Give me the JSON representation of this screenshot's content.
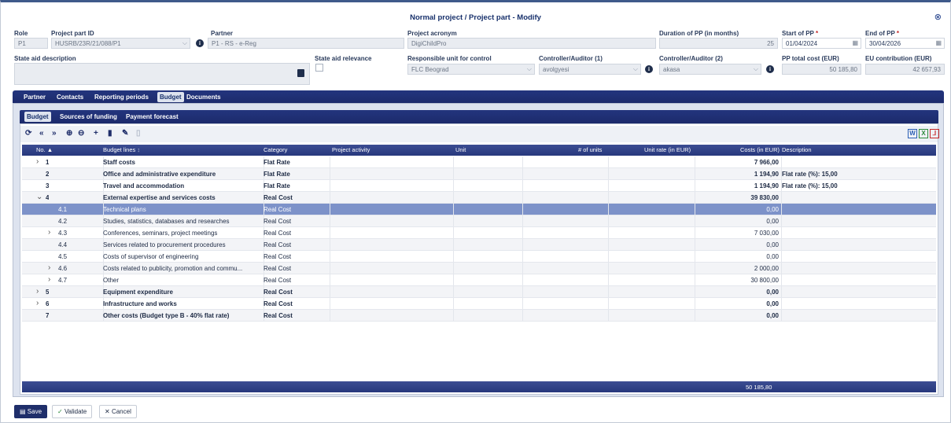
{
  "title": "Normal project / Project part - Modify",
  "form": {
    "role": {
      "label": "Role",
      "value": "P1"
    },
    "project_part_id": {
      "label": "Project part ID",
      "value": "HUSRB/23R/21/088/P1"
    },
    "partner": {
      "label": "Partner",
      "value": "P1 - RS - e-Reg"
    },
    "project_acronym": {
      "label": "Project acronym",
      "value": "DigiChildPro"
    },
    "duration": {
      "label": "Duration of PP (in months)",
      "value": "25"
    },
    "start": {
      "label": "Start of PP",
      "value": "01/04/2024"
    },
    "end": {
      "label": "End of PP",
      "value": "30/04/2026"
    },
    "state_aid_description": {
      "label": "State aid description",
      "value": ""
    },
    "state_aid_relevance": {
      "label": "State aid relevance"
    },
    "responsible_unit": {
      "label": "Responsible unit for control",
      "value": "FLC Beograd"
    },
    "controller1": {
      "label": "Controller/Auditor (1)",
      "value": "avolgyesi"
    },
    "controller2": {
      "label": "Controller/Auditor (2)",
      "value": "akasa"
    },
    "pp_total": {
      "label": "PP total cost (EUR)",
      "value": "50 185,80"
    },
    "eu_contribution": {
      "label": "EU contribution (EUR)",
      "value": "42 657,93"
    },
    "required_mark": "*"
  },
  "main_tabs": [
    "Partner",
    "Contacts",
    "Reporting periods",
    "Budget",
    "Documents"
  ],
  "sub_tabs": [
    "Budget",
    "Sources of funding",
    "Payment forecast"
  ],
  "export": {
    "word": "W",
    "excel": "X"
  },
  "grid": {
    "columns": {
      "no": "No.",
      "sort_asc": "▲",
      "budget_lines": "Budget lines",
      "sort_mark": "↕",
      "category": "Category",
      "activity": "Project activity",
      "unit": "Unit",
      "units": "# of units",
      "rate": "Unit rate (in EUR)",
      "costs": "Costs (in EUR)",
      "description": "Description"
    },
    "rows": [
      {
        "no": "1",
        "line": "Staff costs",
        "cat": "Flat Rate",
        "cost": "7 966,00",
        "desc": "",
        "bold": true,
        "expander": "›",
        "level": 0
      },
      {
        "no": "2",
        "line": "Office and administrative expenditure",
        "cat": "Flat Rate",
        "cost": "1 194,90",
        "desc": "Flat rate (%): 15,00",
        "bold": true,
        "expander": "",
        "level": 0
      },
      {
        "no": "3",
        "line": "Travel and accommodation",
        "cat": "Flat Rate",
        "cost": "1 194,90",
        "desc": "Flat rate (%): 15,00",
        "bold": true,
        "expander": "",
        "level": 0
      },
      {
        "no": "4",
        "line": "External expertise and services costs",
        "cat": "Real Cost",
        "cost": "39 830,00",
        "desc": "",
        "bold": true,
        "expander": "⌄",
        "level": 0
      },
      {
        "no": "4.1",
        "line": "Technical plans",
        "cat": "Real Cost",
        "cost": "0,00",
        "desc": "",
        "bold": false,
        "expander": "",
        "level": 1,
        "selected": true
      },
      {
        "no": "4.2",
        "line": "Studies, statistics, databases and researches",
        "cat": "Real Cost",
        "cost": "0,00",
        "desc": "",
        "bold": false,
        "expander": "",
        "level": 1
      },
      {
        "no": "4.3",
        "line": "Conferences, seminars, project meetings",
        "cat": "Real Cost",
        "cost": "7 030,00",
        "desc": "",
        "bold": false,
        "expander": "›",
        "level": 1
      },
      {
        "no": "4.4",
        "line": "Services related to procurement procedures",
        "cat": "Real Cost",
        "cost": "0,00",
        "desc": "",
        "bold": false,
        "expander": "",
        "level": 1
      },
      {
        "no": "4.5",
        "line": "Costs of supervisor of engineering",
        "cat": "Real Cost",
        "cost": "0,00",
        "desc": "",
        "bold": false,
        "expander": "",
        "level": 1
      },
      {
        "no": "4.6",
        "line": "Costs related to publicity, promotion and commu...",
        "cat": "Real Cost",
        "cost": "2 000,00",
        "desc": "",
        "bold": false,
        "expander": "›",
        "level": 1
      },
      {
        "no": "4.7",
        "line": "Other",
        "cat": "Real Cost",
        "cost": "30 800,00",
        "desc": "",
        "bold": false,
        "expander": "›",
        "level": 1
      },
      {
        "no": "5",
        "line": "Equipment expenditure",
        "cat": "Real Cost",
        "cost": "0,00",
        "desc": "",
        "bold": true,
        "expander": "›",
        "level": 0
      },
      {
        "no": "6",
        "line": "Infrastructure and works",
        "cat": "Real Cost",
        "cost": "0,00",
        "desc": "",
        "bold": true,
        "expander": "›",
        "level": 0
      },
      {
        "no": "7",
        "line": "Other costs (Budget type B - 40% flat rate)",
        "cat": "Real Cost",
        "cost": "0,00",
        "desc": "",
        "bold": true,
        "expander": "",
        "level": 0
      }
    ],
    "total": "50 185,80"
  },
  "buttons": {
    "save": "Save",
    "validate": "Validate",
    "cancel": "Cancel"
  }
}
